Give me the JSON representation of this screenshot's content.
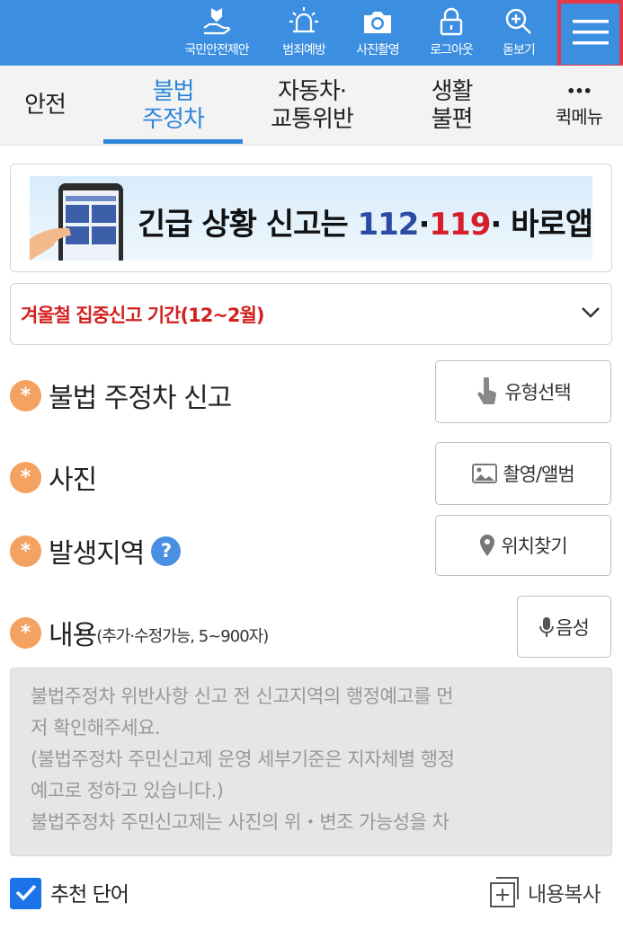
{
  "top_menu": {
    "items": [
      {
        "label": "국민안전제안",
        "icon": "hand-heart-icon"
      },
      {
        "label": "범죄예방",
        "icon": "siren-icon"
      },
      {
        "label": "사진촬영",
        "icon": "camera-icon"
      },
      {
        "label": "로그아웃",
        "icon": "lock-icon"
      },
      {
        "label": "돋보기",
        "icon": "magnifier-plus-icon"
      }
    ],
    "menu_icon": "hamburger-icon",
    "highlight_color": "#e63946",
    "bar_color": "#3c8fe0"
  },
  "tabs": [
    {
      "line1": "안전",
      "line2": ""
    },
    {
      "line1": "불법",
      "line2": "주정차"
    },
    {
      "line1": "자동차·",
      "line2": "교통위반"
    },
    {
      "line1": "생활",
      "line2": "불편"
    },
    {
      "line1": "•••",
      "line2": "퀵메뉴"
    }
  ],
  "active_tab": "불법 주정차",
  "banner": {
    "text_prefix": "긴급 상황 신고는 ",
    "num1": "112",
    "dot1": "·",
    "num2": "119",
    "text_suffix": "· 바로앱!"
  },
  "notice": {
    "text": "겨울철 집중신고 기간(12~2월)",
    "icon": "chevron-down-icon"
  },
  "form": {
    "required_mark": "*",
    "type_row": {
      "title": "불법 주정차 신고",
      "button": "유형선택",
      "button_icon": "touch-hand-icon"
    },
    "photo_row": {
      "title": "사진",
      "button": "촬영/앨범",
      "button_icon": "image-icon"
    },
    "location_row": {
      "title": "발생지역",
      "help": "?",
      "button": "위치찾기",
      "button_icon": "map-pin-icon"
    },
    "content_row": {
      "title": "내용",
      "subtitle": "(추가·수정가능, 5~900자)",
      "button": "음성",
      "button_icon": "microphone-icon"
    },
    "content_lines": [
      "불법주정차 위반사항 신고 전 신고지역의 행정예고를 먼",
      "저 확인해주세요.",
      "(불법주정차 주민신고제 운영 세부기준은 지자체별 행정",
      "예고로 정하고 있습니다.)",
      "불법주정차 주민신고제는 사진의 위・변조 가능성을 차"
    ]
  },
  "bottom": {
    "recommend_label": "추천 단어",
    "recommend_checked": true,
    "copy_label": "내용복사",
    "copy_icon": "copy-plus-icon"
  },
  "colors": {
    "accent": "#2d86d9",
    "notice_red": "#d32020",
    "required_orange": "#f4a261",
    "help_blue": "#4a90e2"
  }
}
